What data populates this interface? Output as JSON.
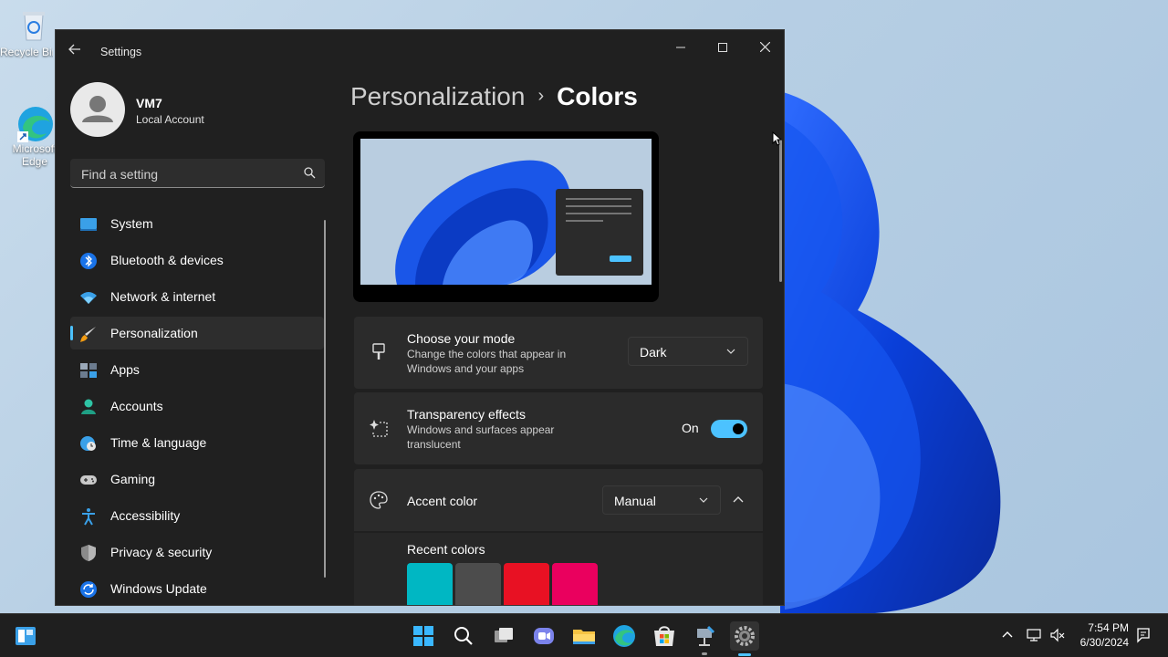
{
  "desktop": {
    "icons": [
      {
        "label": "Recycle Bin",
        "icon": "recycle-bin-icon"
      },
      {
        "label": "Microsoft Edge",
        "icon": "edge-icon"
      }
    ]
  },
  "window": {
    "title": "Settings",
    "controls": [
      "minimize",
      "maximize",
      "close"
    ]
  },
  "profile": {
    "name": "VM7",
    "account_type": "Local Account"
  },
  "search": {
    "placeholder": "Find a setting"
  },
  "nav": {
    "items": [
      {
        "label": "System",
        "icon": "system-icon"
      },
      {
        "label": "Bluetooth & devices",
        "icon": "bluetooth-icon"
      },
      {
        "label": "Network & internet",
        "icon": "wifi-icon"
      },
      {
        "label": "Personalization",
        "icon": "brush-icon",
        "active": true
      },
      {
        "label": "Apps",
        "icon": "apps-icon"
      },
      {
        "label": "Accounts",
        "icon": "accounts-icon"
      },
      {
        "label": "Time & language",
        "icon": "time-language-icon"
      },
      {
        "label": "Gaming",
        "icon": "gamepad-icon"
      },
      {
        "label": "Accessibility",
        "icon": "accessibility-icon"
      },
      {
        "label": "Privacy & security",
        "icon": "shield-icon"
      },
      {
        "label": "Windows Update",
        "icon": "update-icon"
      }
    ]
  },
  "breadcrumb": {
    "parent": "Personalization",
    "separator": "›",
    "current": "Colors"
  },
  "settings": {
    "mode": {
      "title": "Choose your mode",
      "description": "Change the colors that appear in Windows and your apps",
      "value": "Dark"
    },
    "transparency": {
      "title": "Transparency effects",
      "description": "Windows and surfaces appear translucent",
      "state_label": "On",
      "enabled": true
    },
    "accent": {
      "title": "Accent color",
      "value": "Manual",
      "recent_colors_label": "Recent colors",
      "recent_colors": [
        "#00b7c3",
        "#4c4c4c",
        "#e81123",
        "#ea005e"
      ]
    }
  },
  "colors": {
    "accent": "#4cc2ff",
    "window_bg": "#202020",
    "card_bg": "#2b2b2b"
  },
  "taskbar": {
    "apps": [
      "start-icon",
      "search-icon",
      "task-view-icon",
      "chat-icon",
      "file-explorer-icon",
      "edge-icon",
      "store-icon",
      "network-tool-icon",
      "settings-icon"
    ],
    "time": "7:54 PM",
    "date": "6/30/2024"
  }
}
